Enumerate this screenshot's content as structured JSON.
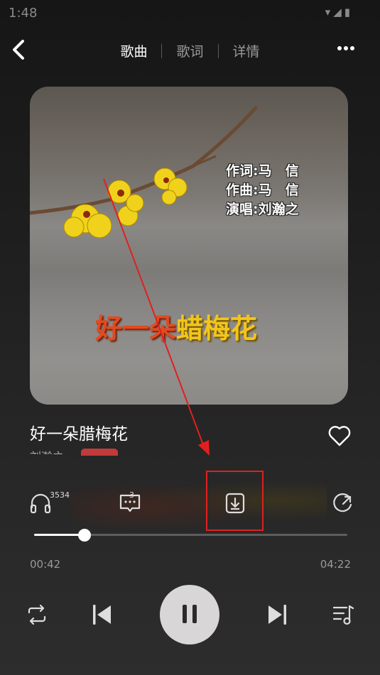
{
  "status": {
    "time": "1:48",
    "icons": "▾◢▮"
  },
  "header": {
    "tabs": [
      {
        "label": "歌曲",
        "active": true
      },
      {
        "label": "歌词",
        "active": false
      },
      {
        "label": "详情",
        "active": false
      }
    ]
  },
  "cover": {
    "credits": "作词:马　信\n作曲:马　信\n演唱:刘瀚之",
    "title_part1": "好一朵",
    "title_part2": "蜡梅花"
  },
  "song": {
    "title": "好一朵腊梅花",
    "artist": "刘瀚之"
  },
  "actions": {
    "listen_count": "3534",
    "comment_count": "3"
  },
  "progress": {
    "current": "00:42",
    "total": "04:22",
    "fraction": 0.16
  },
  "colors": {
    "highlight": "#e02020",
    "accent": "#ffffff"
  }
}
